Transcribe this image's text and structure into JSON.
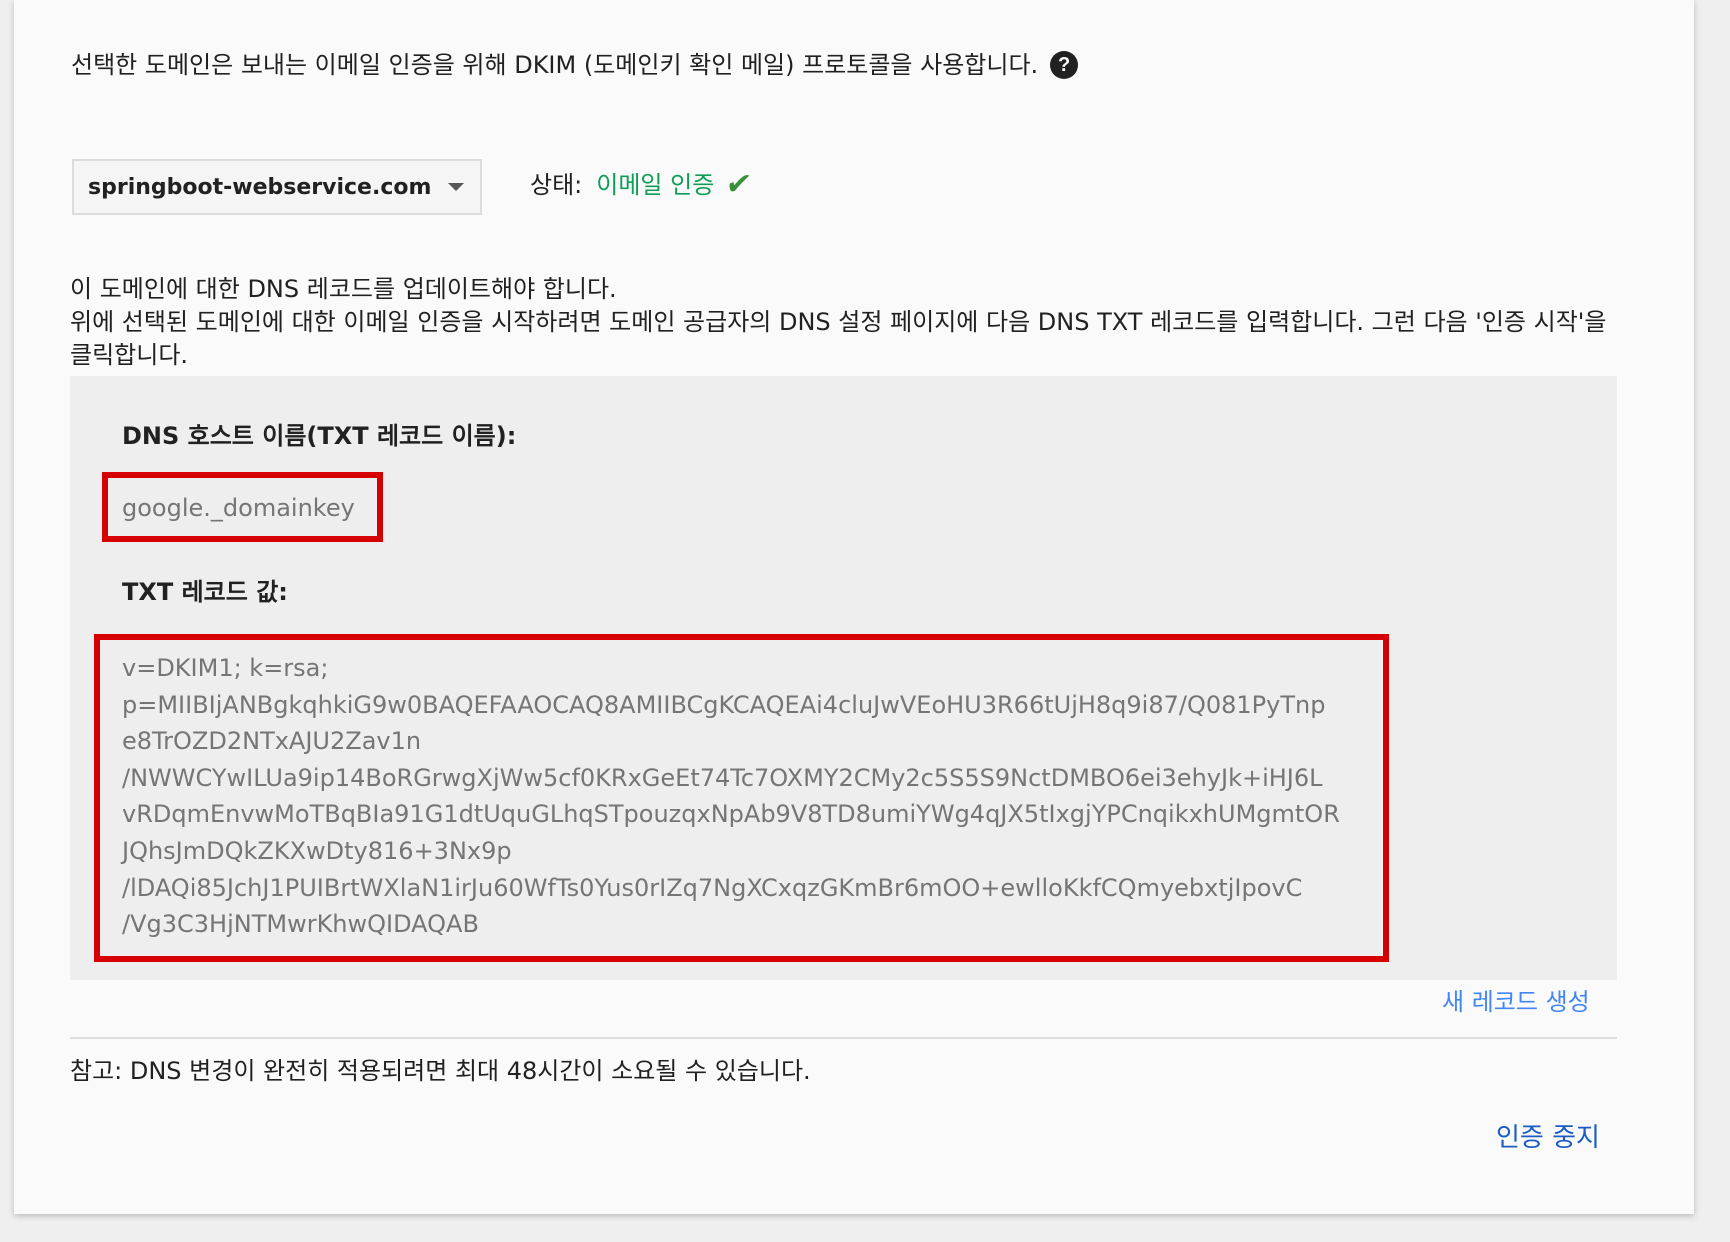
{
  "intro": {
    "text": "선택한 도메인은 보내는 이메일 인증을 위해 DKIM (도메인키 확인 메일) 프로토콜을 사용합니다.",
    "help_glyph": "?",
    "help_icon": "help-circle-icon"
  },
  "domain_select": {
    "selected": "springboot-webservice.com",
    "caret_icon": "chevron-down-icon"
  },
  "status": {
    "label": "상태:",
    "value": "이메일 인증",
    "value_color": "#0f9d58",
    "check_glyph": "✔",
    "check_icon": "check-icon"
  },
  "notice": {
    "line1": "이 도메인에 대한 DNS 레코드를 업데이트해야 합니다.",
    "line2": "위에 선택된 도메인에 대한 이메일 인증을 시작하려면 도메인 공급자의 DNS 설정 페이지에 다음 DNS TXT 레코드를 입력합니다. 그런 다음 '인증 시작'을 클릭합니다."
  },
  "record": {
    "host_title": "DNS 호스트 이름(TXT 레코드 이름):",
    "host_value": "google._domainkey",
    "txt_title": "TXT 레코드 값:",
    "txt_lines": [
      "v=DKIM1; k=rsa;",
      "p=MIIBIjANBgkqhkiG9w0BAQEFAAOCAQ8AMIIBCgKCAQEAi4cluJwVEoHU3R66tUjH8q9i87/Q081PyTnp",
      "e8TrOZD2NTxAJU2Zav1n",
      "/NWWCYwILUa9ip14BoRGrwgXjWw5cf0KRxGeEt74Tc7OXMY2CMy2c5S5S9NctDMBO6ei3ehyJk+iHJ6L",
      "vRDqmEnvwMoTBqBIa91G1dtUquGLhqSTpouzqxNpAb9V8TD8umiYWg4qJX5tIxgjYPCnqikxhUMgmtOR",
      "JQhsJmDQkZKXwDty816+3Nx9p",
      "/lDAQi85JchJ1PUIBrtWXlaN1irJu60WfTs0Yus0rIZq7NgXCxqzGKmBr6mOO+ewlloKkfCQmyebxtjIpovC",
      "/Vg3C3HjNTMwrKhwQIDAQAB"
    ],
    "highlight_color": "#d50000"
  },
  "new_record_link": "새 레코드 생성",
  "footnote": "참고: DNS 변경이 완전히 적용되려면 최대 48시간이 소요될 수 있습니다.",
  "stop_link": "인증 중지",
  "colors": {
    "link": "#4285f4",
    "link_dark": "#1a5bc4"
  }
}
